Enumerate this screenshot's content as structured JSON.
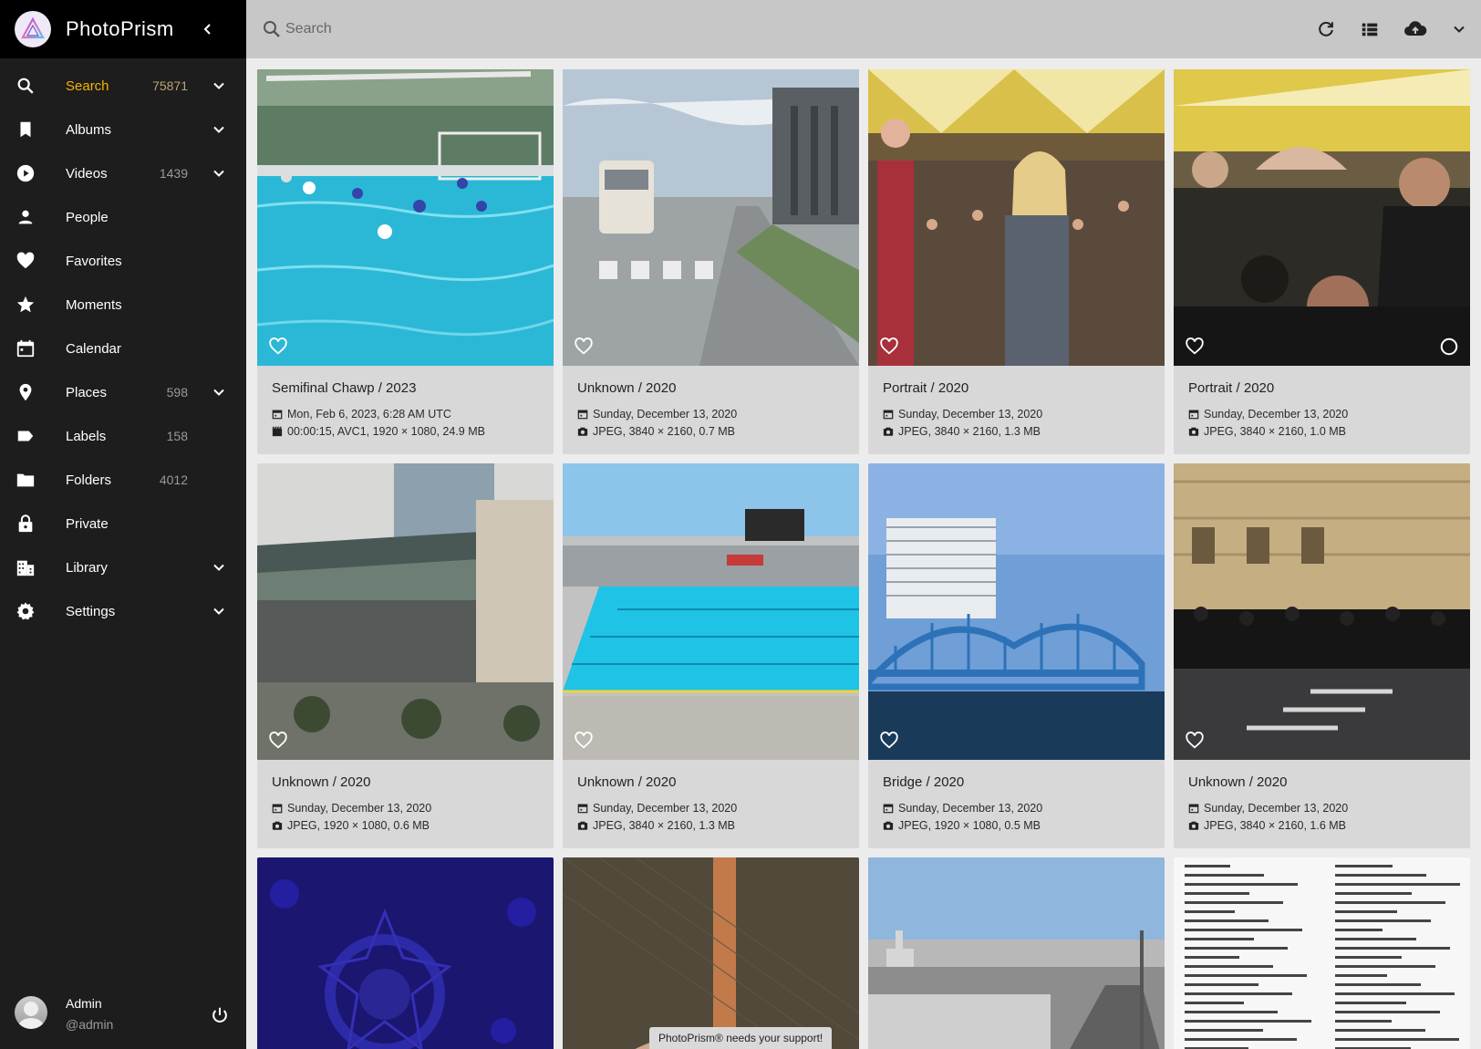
{
  "app": {
    "name": "PhotoPrism"
  },
  "sidebar": {
    "items": [
      {
        "label": "Search",
        "count": "75871",
        "icon": "search-icon",
        "expand": true,
        "active": true
      },
      {
        "label": "Albums",
        "count": "",
        "icon": "bookmark-icon",
        "expand": true
      },
      {
        "label": "Videos",
        "count": "1439",
        "icon": "play-circle-icon",
        "expand": true
      },
      {
        "label": "People",
        "count": "",
        "icon": "person-icon",
        "expand": false
      },
      {
        "label": "Favorites",
        "count": "",
        "icon": "heart-icon",
        "expand": false
      },
      {
        "label": "Moments",
        "count": "",
        "icon": "star-icon",
        "expand": false
      },
      {
        "label": "Calendar",
        "count": "",
        "icon": "calendar-icon",
        "expand": false
      },
      {
        "label": "Places",
        "count": "598",
        "icon": "map-pin-icon",
        "expand": true
      },
      {
        "label": "Labels",
        "count": "158",
        "icon": "label-icon",
        "expand": false
      },
      {
        "label": "Folders",
        "count": "4012",
        "icon": "folder-icon",
        "expand": false
      },
      {
        "label": "Private",
        "count": "",
        "icon": "lock-icon",
        "expand": false
      },
      {
        "label": "Library",
        "count": "",
        "icon": "library-icon",
        "expand": true
      },
      {
        "label": "Settings",
        "count": "",
        "icon": "gear-icon",
        "expand": true
      }
    ],
    "user": {
      "name": "Admin",
      "handle": "@admin"
    }
  },
  "toolbar": {
    "search_placeholder": "Search"
  },
  "photos": [
    {
      "title": "Semifinal Chawp / 2023",
      "date": "Mon, Feb 6, 2023, 6:28 AM UTC",
      "details": "00:00:15, AVC1, 1920 × 1080, 24.9 MB",
      "kind": "video",
      "scene": "pool1"
    },
    {
      "title": "Unknown / 2020",
      "date": "Sunday, December 13, 2020",
      "details": "JPEG, 3840 × 2160, 0.7 MB",
      "kind": "photo",
      "scene": "road"
    },
    {
      "title": "Portrait / 2020",
      "date": "Sunday, December 13, 2020",
      "details": "JPEG, 3840 × 2160, 1.3 MB",
      "kind": "photo",
      "scene": "hall"
    },
    {
      "title": "Portrait / 2020",
      "date": "Sunday, December 13, 2020",
      "details": "JPEG, 3840 × 2160, 1.0 MB",
      "kind": "photo",
      "scene": "crowd"
    },
    {
      "title": "Unknown / 2020",
      "date": "Sunday, December 13, 2020",
      "details": "JPEG, 1920 × 1080, 0.6 MB",
      "kind": "photo",
      "scene": "building"
    },
    {
      "title": "Unknown / 2020",
      "date": "Sunday, December 13, 2020",
      "details": "JPEG, 3840 × 2160, 1.3 MB",
      "kind": "photo",
      "scene": "pool2"
    },
    {
      "title": "Bridge / 2020",
      "date": "Sunday, December 13, 2020",
      "details": "JPEG, 1920 × 1080, 0.5 MB",
      "kind": "photo",
      "scene": "bridge"
    },
    {
      "title": "Unknown / 2020",
      "date": "Sunday, December 13, 2020",
      "details": "JPEG, 3840 × 2160, 1.6 MB",
      "kind": "photo",
      "scene": "street"
    },
    {
      "title": "",
      "date": "",
      "details": "",
      "kind": "photo",
      "scene": "pattern"
    },
    {
      "title": "",
      "date": "",
      "details": "",
      "kind": "photo",
      "scene": "fabric"
    },
    {
      "title": "",
      "date": "",
      "details": "",
      "kind": "photo",
      "scene": "airport"
    },
    {
      "title": "",
      "date": "",
      "details": "",
      "kind": "photo",
      "scene": "document"
    }
  ],
  "support_banner": "PhotoPrism® needs your support!",
  "colors": {
    "sidebar_bg": "#1d1d1d",
    "brand_bg": "#000000",
    "active_accent": "#f4b400",
    "toolbar_bg": "#c7c7c7",
    "content_bg": "#ececec",
    "card_bg": "#d8d8d8"
  }
}
